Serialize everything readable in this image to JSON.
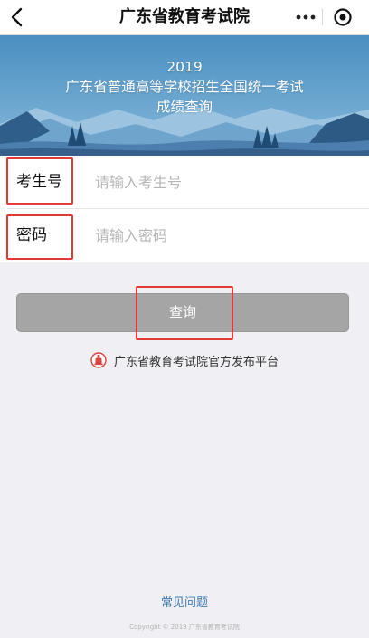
{
  "nav": {
    "title": "广东省教育考试院",
    "back_icon": "chevron-left-icon",
    "more_icon": "more-dots-icon",
    "close_icon": "target-circle-icon"
  },
  "banner": {
    "line1": "2019",
    "line2": "广东省普通高等学校招生全国统一考试",
    "line3": "成绩查询"
  },
  "form": {
    "exam_number": {
      "label": "考生号",
      "placeholder": "请输入考生号",
      "value": ""
    },
    "password": {
      "label": "密码",
      "placeholder": "请输入密码",
      "value": ""
    }
  },
  "query_button": {
    "label": "查询"
  },
  "official_notice": {
    "text": "广东省教育考试院官方发布平台",
    "icon": "emblem-icon"
  },
  "faq": {
    "label": "常见问题"
  },
  "copyright": {
    "text": "Copyright © 2019 广东省教育考试院"
  },
  "colors": {
    "highlight": "#e53935",
    "button": "#a5a5a5",
    "link": "#3c78b0",
    "banner_sky": "#4d93c3"
  }
}
